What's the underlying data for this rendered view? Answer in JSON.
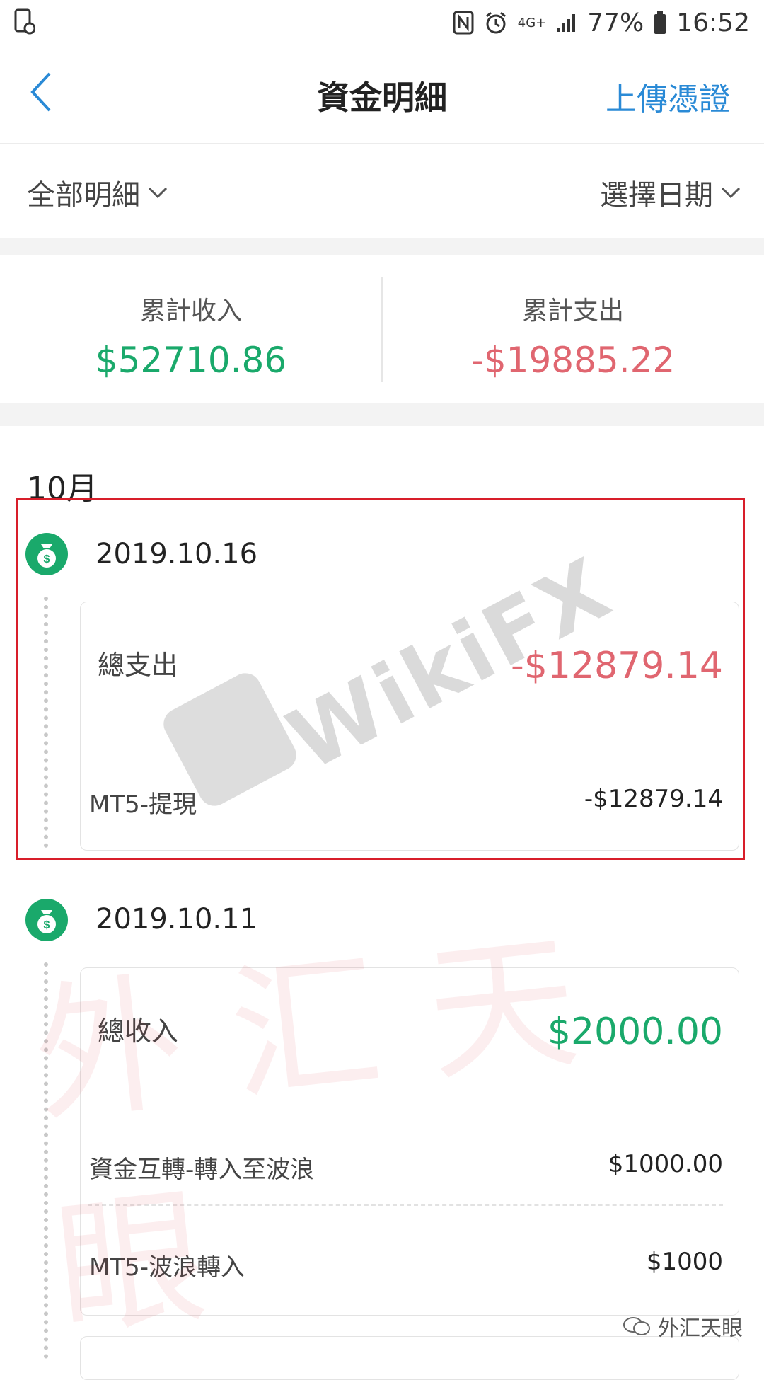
{
  "status_bar": {
    "battery": "77%",
    "time": "16:52",
    "network": "4G+"
  },
  "header": {
    "title": "資金明細",
    "action": "上傳憑證"
  },
  "filter": {
    "left_label": "全部明細",
    "right_label": "選擇日期"
  },
  "summary": {
    "income_label": "累計收入",
    "income_value": "$52710.86",
    "expense_label": "累計支出",
    "expense_value": "-$19885.22"
  },
  "month": "10月",
  "entries": [
    {
      "date": "2019.10.16",
      "total_label": "總支出",
      "total_value": "-$12879.14",
      "rows": [
        {
          "label": "MT5-提現",
          "value": "-$12879.14"
        }
      ]
    },
    {
      "date": "2019.10.11",
      "total_label": "總收入",
      "total_value": "$2000.00",
      "rows": [
        {
          "label": "資金互轉-轉入至波浪",
          "value": "$1000.00"
        },
        {
          "label": "MT5-波浪轉入",
          "value": "$1000"
        }
      ]
    }
  ],
  "watermark": {
    "brand": "WikiFX",
    "stamp": "外汇天眼"
  },
  "footer": {
    "brand_tag": "外汇天眼"
  },
  "colors": {
    "income": "#1aa96b",
    "expense": "#e06670",
    "accent": "#2a8ad6",
    "highlight": "#d81e2a"
  }
}
